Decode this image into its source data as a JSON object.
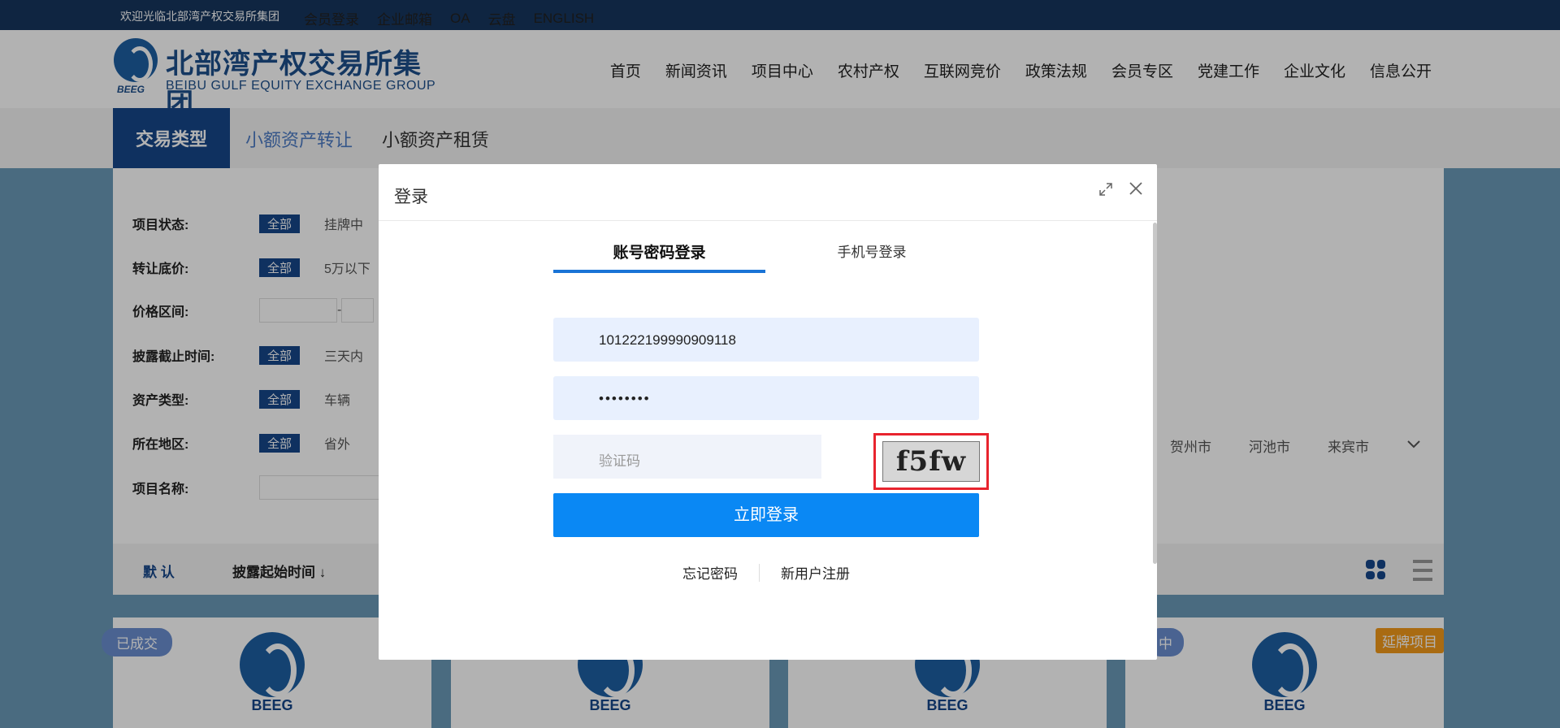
{
  "topbar": {
    "welcome": "欢迎光临北部湾产权交易所集团",
    "links": [
      "会员登录",
      "企业邮箱",
      "OA",
      "云盘",
      "ENGLISH"
    ]
  },
  "logo": {
    "cn": "北部湾产权交易所集团",
    "en": "BEIBU GULF EQUITY EXCHANGE GROUP",
    "abbr": "BEEG"
  },
  "nav": [
    "首页",
    "新闻资讯",
    "项目中心",
    "农村产权",
    "互联网竞价",
    "政策法规",
    "会员专区",
    "党建工作",
    "企业文化",
    "信息公开"
  ],
  "tabs": {
    "type_label": "交易类型",
    "tab1": "小额资产转让",
    "tab2": "小额资产租赁"
  },
  "filters": {
    "all": "全部",
    "status_label": "项目状态:",
    "status_opt": "挂牌中",
    "price_label": "转让底价:",
    "price_opt": "5万以下",
    "range_label": "价格区间:",
    "range_sep": "-",
    "deadline_label": "披露截止时间:",
    "deadline_opt": "三天内",
    "asset_label": "资产类型:",
    "asset_opt": "车辆",
    "region_label": "所在地区:",
    "region_opt": "省外",
    "name_label": "项目名称:",
    "regions": [
      "贺州市",
      "河池市",
      "来宾市"
    ]
  },
  "sort": {
    "default": "默 认",
    "by_start": "披露起始时间 ↓"
  },
  "cards": {
    "badge_done": "已成交",
    "badge_mid": "中",
    "badge_ext": "延牌项目",
    "logo_text": "BEEG"
  },
  "modal": {
    "title": "登录",
    "tab_account": "账号密码登录",
    "tab_phone": "手机号登录",
    "username": "101222199990909118",
    "password": "••••••••",
    "captcha_placeholder": "验证码",
    "captcha_text": "f5fw",
    "login_button": "立即登录",
    "forgot": "忘记密码",
    "register": "新用户注册"
  }
}
